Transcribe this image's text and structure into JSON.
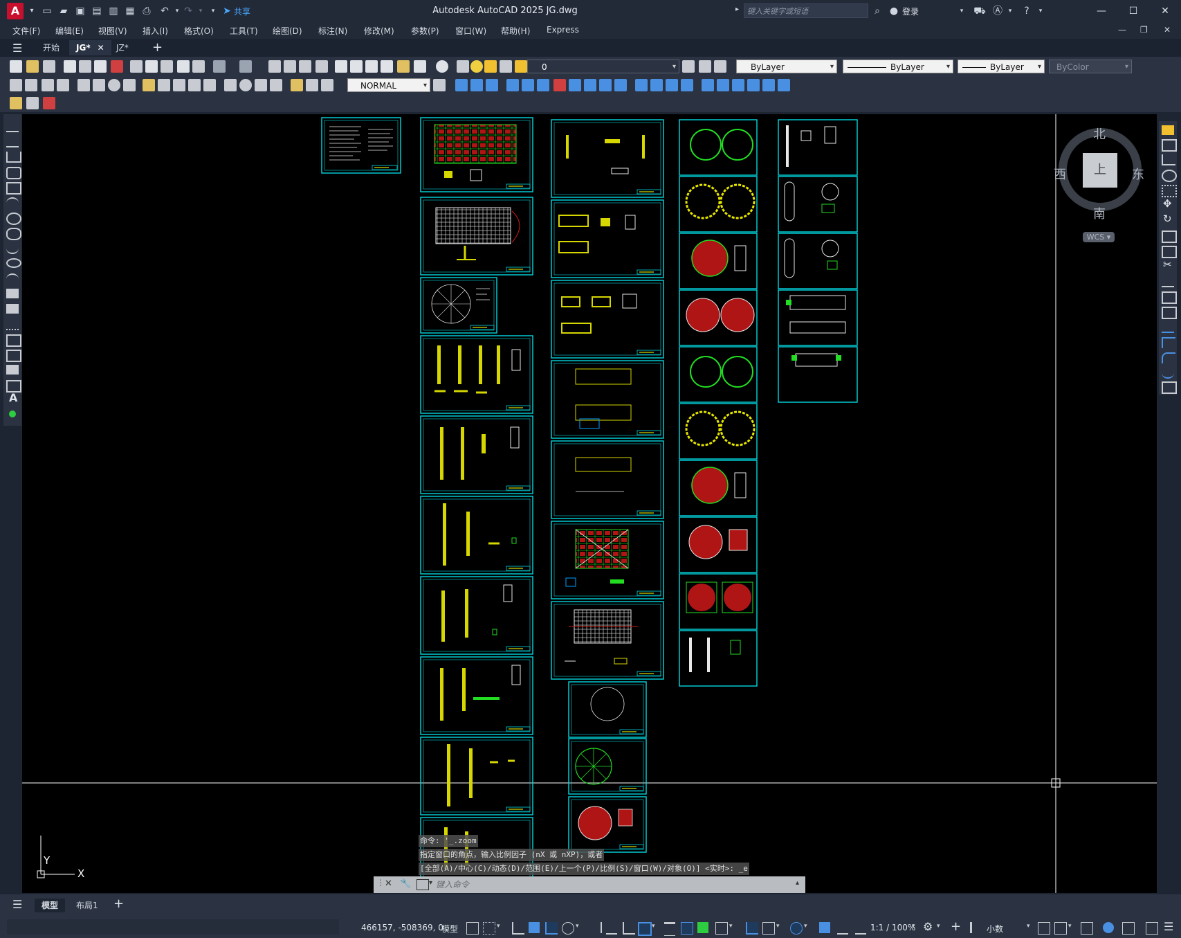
{
  "title_bar": {
    "title": "Autodesk AutoCAD 2025    JG.dwg",
    "app_logo": "A",
    "share_label": "共享",
    "search_placeholder": "键入关键字或短语",
    "login_label": "登录"
  },
  "menu": [
    "文件(F)",
    "编辑(E)",
    "视图(V)",
    "插入(I)",
    "格式(O)",
    "工具(T)",
    "绘图(D)",
    "标注(N)",
    "修改(M)",
    "参数(P)",
    "窗口(W)",
    "帮助(H)",
    "Express"
  ],
  "doc_tabs": {
    "start": "开始",
    "active": "JG*",
    "other": "JZ*"
  },
  "toolbar": {
    "layer_value": "0",
    "color_value": "ByLayer",
    "linetype_value": "ByLayer",
    "lineweight_value": "ByLayer",
    "plotstyle_value": "ByColor",
    "dimstyle_value": "NORMAL"
  },
  "viewcube": {
    "north": "北",
    "south": "南",
    "east": "东",
    "west": "西",
    "top_face": "上",
    "wcs_label": "WCS"
  },
  "ucs": {
    "x_label": "X",
    "y_label": "Y"
  },
  "command_line": {
    "line1": "命令:  '_.zoom",
    "line2": "指定窗口的角点，输入比例因子 (nX 或 nXP)，或者",
    "line3": "[全部(A)/中心(C)/动态(D)/范围(E)/上一个(P)/比例(S)/窗口(W)/对象(O)] <实时>: _e",
    "input_placeholder": "键入命令"
  },
  "layout_tabs": {
    "model": "模型",
    "layout1": "布局1"
  },
  "status_bar": {
    "coords": "466157, -508369, 0",
    "mode": "模型",
    "scale": "1:1 / 100%",
    "units": "小数"
  },
  "colors": {
    "sheet_border": "#00d8e0",
    "canvas": "#000000",
    "drawing_yellow": "#e6e600",
    "drawing_green": "#22dd22",
    "drawing_red": "#d01818",
    "drawing_white": "#e8e8e8"
  }
}
